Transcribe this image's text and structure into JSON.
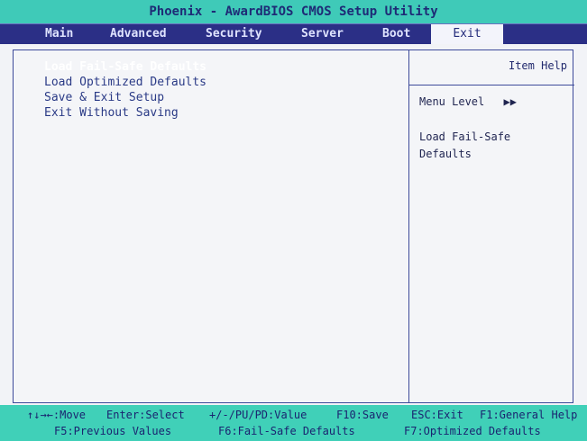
{
  "title": "Phoenix - AwardBIOS CMOS Setup Utility",
  "tabs": [
    {
      "label": "Main"
    },
    {
      "label": "Advanced"
    },
    {
      "label": "Security"
    },
    {
      "label": "Server"
    },
    {
      "label": "Boot"
    },
    {
      "label": "Exit",
      "selected": true
    }
  ],
  "options": [
    {
      "label": "Load Fail-Safe Defaults",
      "highlighted": true
    },
    {
      "label": "Load Optimized Defaults"
    },
    {
      "label": "Save & Exit Setup"
    },
    {
      "label": "Exit Without Saving"
    }
  ],
  "help": {
    "header": "Item Help",
    "menu_level": "Menu Level",
    "menu_level_marker": "▶▶",
    "text": "Load Fail-Safe Defaults"
  },
  "footer": {
    "row1": [
      "↑↓→←:Move",
      "Enter:Select",
      "+/-/PU/PD:Value",
      "F10:Save",
      "ESC:Exit",
      "F1:General Help"
    ],
    "row2": [
      "F5:Previous Values",
      "F6:Fail-Safe Defaults",
      "F7:Optimized Defaults"
    ]
  },
  "colors": {
    "title_bar": "#3fcab8",
    "menu_bar": "#2b2f86",
    "footer_bar": "#40d0b8",
    "selected_tab_bg": "#f3f4fb"
  }
}
